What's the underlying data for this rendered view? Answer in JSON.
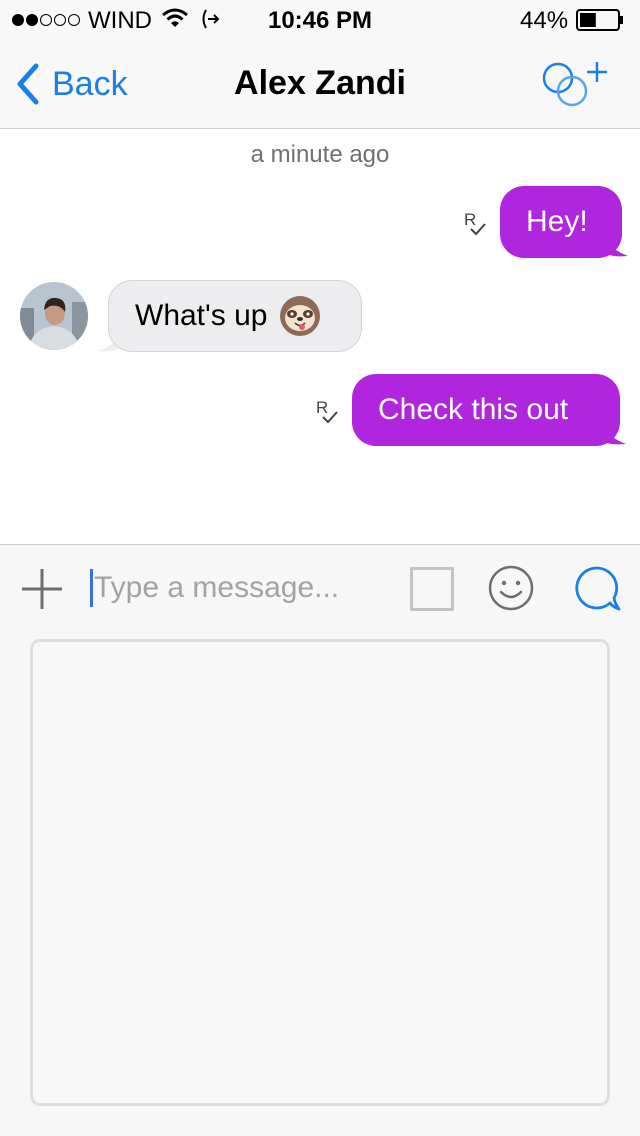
{
  "status_bar": {
    "carrier": "WIND",
    "time": "10:46 PM",
    "battery": "44%",
    "battery_level": 0.44,
    "signal_bars_filled": 2,
    "signal_bars_total": 5
  },
  "nav": {
    "back_label": "Back",
    "title": "Alex Zandi"
  },
  "conversation": {
    "timestamp": "a minute ago",
    "messages": [
      {
        "direction": "outgoing",
        "text": "Hey!",
        "receipt": "R"
      },
      {
        "direction": "incoming",
        "text": "What's up",
        "emoji": "sloth-emoji"
      },
      {
        "direction": "outgoing",
        "text": "Check this out",
        "receipt": "R"
      }
    ]
  },
  "composer": {
    "placeholder": "Type a message..."
  },
  "colors": {
    "accent": "#1a7fe6",
    "outgoing_bubble": "#b026df",
    "incoming_bubble": "#ededef",
    "cursor": "#3a6fe6"
  },
  "icons": {
    "back": "chevron-left-icon",
    "add_contact": "add-participant-icon",
    "attach": "plus-icon",
    "camera": "square-icon",
    "emoji": "smiley-icon",
    "send": "chat-bubble-icon",
    "wifi": "wifi-icon",
    "battery": "battery-icon",
    "read_receipt": "read-receipt-icon"
  }
}
